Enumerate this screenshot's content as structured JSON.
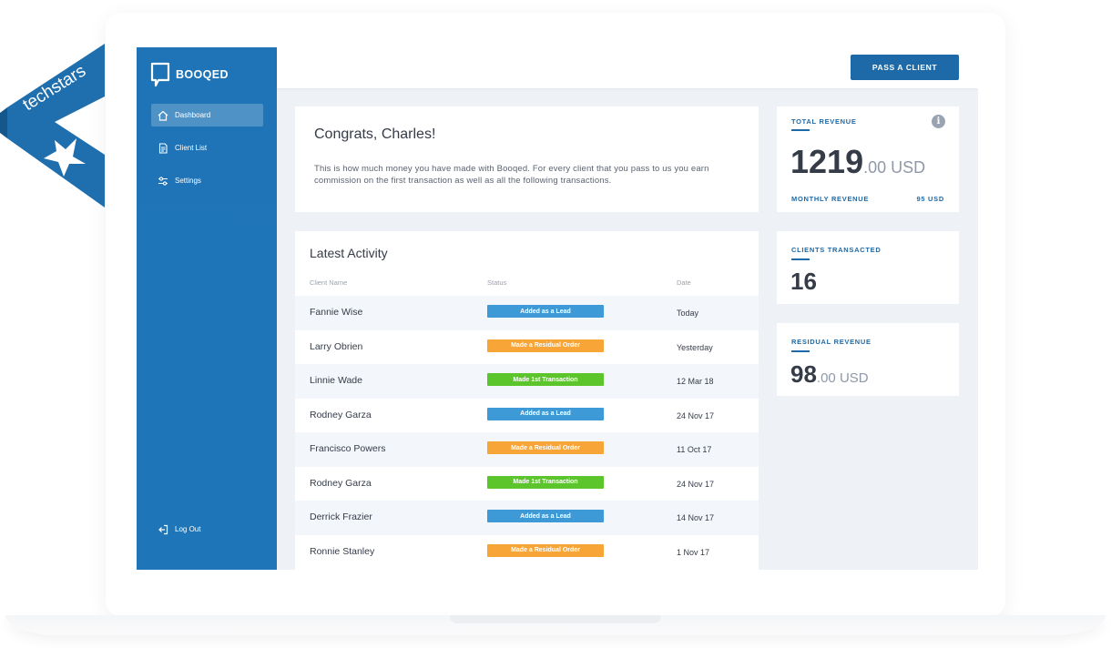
{
  "ribbon": {
    "text": "techstars"
  },
  "brand": {
    "name": "BOOQED"
  },
  "sidebar": {
    "items": [
      {
        "label": "Dashboard",
        "icon": "home-icon"
      },
      {
        "label": "Client List",
        "icon": "document-icon"
      },
      {
        "label": "Settings",
        "icon": "sliders-icon"
      }
    ],
    "logout": {
      "label": "Log Out",
      "icon": "logout-icon"
    }
  },
  "topbar": {
    "pass_client_label": "PASS A CLIENT"
  },
  "congrats": {
    "title": "Congrats, Charles!",
    "body": "This is how much money you have made with Booqed. For every client that you pass to us you earn commission on the first transaction as well as all the following transactions."
  },
  "activity": {
    "title": "Latest Activity",
    "columns": {
      "name": "Client Name",
      "status": "Status",
      "date": "Date"
    },
    "rows": [
      {
        "name": "Fannie Wise",
        "status": "Added as a Lead",
        "date": "Today"
      },
      {
        "name": "Larry Obrien",
        "status": "Made a Residual Order",
        "date": "Yesterday"
      },
      {
        "name": "Linnie Wade",
        "status": "Made 1st Transaction",
        "date": "12 Mar 18"
      },
      {
        "name": "Rodney Garza",
        "status": "Added as a Lead",
        "date": "24 Nov 17"
      },
      {
        "name": "Francisco Powers",
        "status": "Made a Residual Order",
        "date": "11 Oct 17"
      },
      {
        "name": "Rodney Garza",
        "status": "Made 1st Transaction",
        "date": "24 Nov 17"
      },
      {
        "name": "Derrick Frazier",
        "status": "Added as a Lead",
        "date": "14 Nov 17"
      },
      {
        "name": "Ronnie Stanley",
        "status": "Made a Residual Order",
        "date": "1 Nov 17"
      }
    ]
  },
  "status_colors": {
    "Added as a Lead": "#3d9ad6",
    "Made a Residual Order": "#f7a536",
    "Made 1st Transaction": "#5cc52b"
  },
  "stats": {
    "total_revenue": {
      "label": "TOTAL  REVENUE",
      "whole": "1219",
      "decimal": ".00 USD",
      "monthly_label": "MONTHLY REVENUE",
      "monthly_value": "95 USD"
    },
    "clients_transacted": {
      "label": "CLIENTS TRANSACTED",
      "value": "16"
    },
    "residual_revenue": {
      "label": "RESIDUAL REVENUE",
      "whole": "98",
      "decimal": ".00 USD"
    }
  },
  "colors": {
    "sidebar": "#1e74b6",
    "accent": "#1e6aa8",
    "background": "#eef2f7"
  }
}
